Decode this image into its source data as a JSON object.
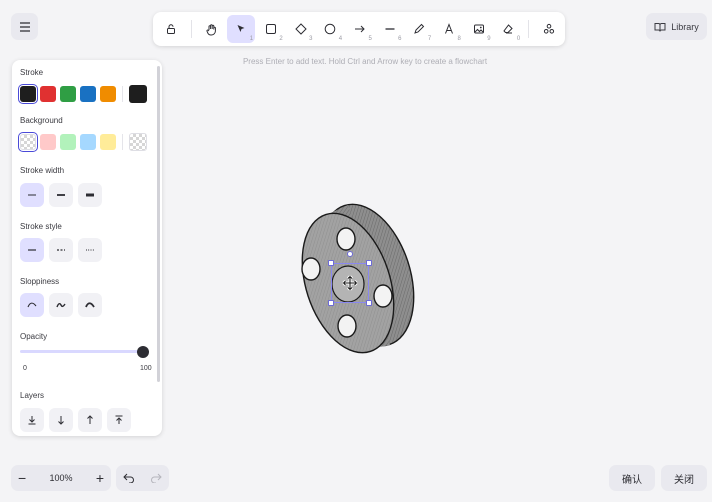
{
  "colors": {
    "accent": "#e0dfff",
    "accent_border": "#4a4ad8",
    "stroke": [
      "#1e1e1e",
      "#e03131",
      "#2f9e44",
      "#1971c2",
      "#f08c00"
    ],
    "stroke_current": "#1e1e1e",
    "background": [
      "transparent",
      "#ffc9c9",
      "#b2f2bb",
      "#a5d8ff",
      "#ffec99"
    ]
  },
  "toolbar": {
    "tools": [
      {
        "name": "lock",
        "icon": "lock-icon",
        "shortcut": ""
      },
      {
        "name": "hand",
        "icon": "hand-icon",
        "shortcut": ""
      },
      {
        "name": "selection",
        "icon": "cursor-icon",
        "shortcut": "1",
        "active": true
      },
      {
        "name": "rectangle",
        "icon": "square-icon",
        "shortcut": "2"
      },
      {
        "name": "diamond",
        "icon": "diamond-icon",
        "shortcut": "3"
      },
      {
        "name": "ellipse",
        "icon": "circle-icon",
        "shortcut": "4"
      },
      {
        "name": "arrow",
        "icon": "arrow-right-icon",
        "shortcut": "5"
      },
      {
        "name": "line",
        "icon": "line-icon",
        "shortcut": "6"
      },
      {
        "name": "draw",
        "icon": "pencil-icon",
        "shortcut": "7"
      },
      {
        "name": "text",
        "icon": "text-icon",
        "shortcut": "8"
      },
      {
        "name": "image",
        "icon": "image-icon",
        "shortcut": "9"
      },
      {
        "name": "eraser",
        "icon": "eraser-icon",
        "shortcut": "0"
      },
      {
        "name": "more-tools",
        "icon": "shapes-icon",
        "shortcut": ""
      }
    ]
  },
  "library_label": "Library",
  "hint": "Press Enter to add text. Hold Ctrl and Arrow key to create a flowchart",
  "panel": {
    "stroke_title": "Stroke",
    "background_title": "Background",
    "stroke_width_title": "Stroke width",
    "stroke_style_title": "Stroke style",
    "sloppiness_title": "Sloppiness",
    "opacity_title": "Opacity",
    "opacity_value": 100,
    "opacity_min": "0",
    "opacity_max": "100",
    "layers_title": "Layers"
  },
  "footer": {
    "zoom_out": "−",
    "zoom_level": "100%",
    "zoom_in": "+",
    "confirm": "确认",
    "close": "关闭"
  }
}
